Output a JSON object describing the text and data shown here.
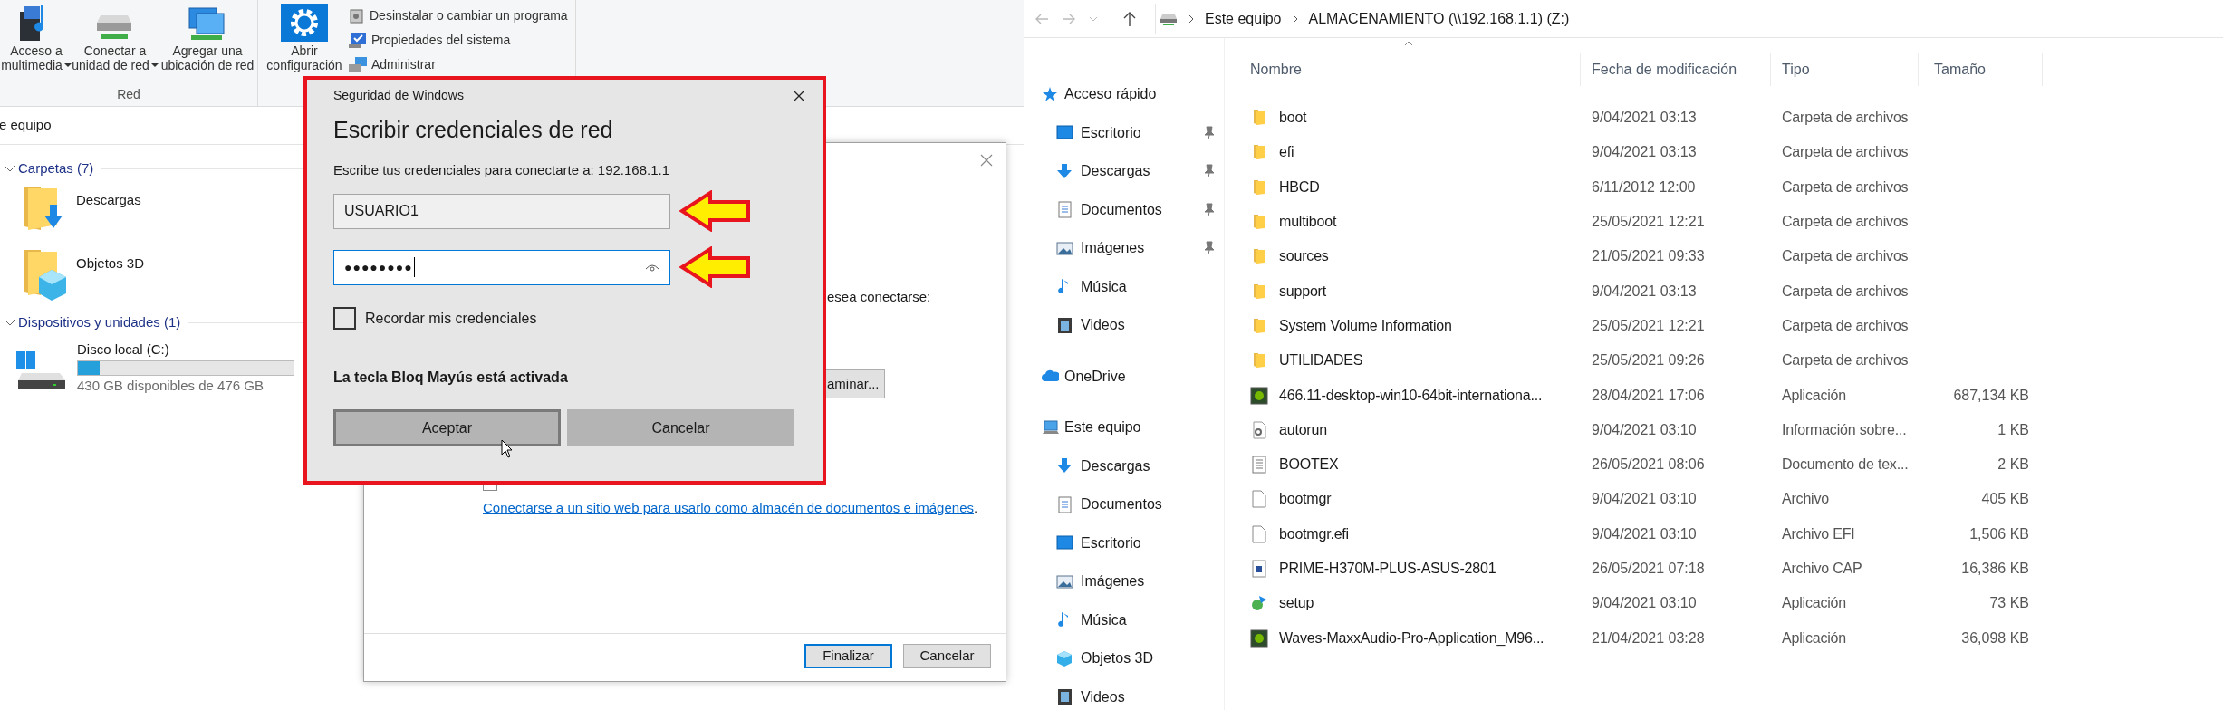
{
  "left_explorer": {
    "ribbon": {
      "groups": [
        {
          "label": "Red",
          "buttons": [
            {
              "kind": "media",
              "lines": [
                "Acceso a",
                "multimedia"
              ],
              "dropdown": true
            },
            {
              "kind": "netdrive",
              "lines": [
                "Conectar a",
                "unidad de red"
              ],
              "dropdown": true
            },
            {
              "kind": "netplace",
              "lines": [
                "Agregar una",
                "ubicación de red"
              ],
              "dropdown": false
            }
          ]
        },
        {
          "buttons": [
            {
              "kind": "settings",
              "lines": [
                "Abrir",
                "configuración"
              ],
              "dropdown": false
            }
          ],
          "small_items": [
            {
              "kind": "uninstall",
              "label": "Desinstalar o cambiar un programa"
            },
            {
              "kind": "sysprops",
              "label": "Propiedades del sistema"
            },
            {
              "kind": "manage",
              "label": "Administrar"
            }
          ]
        }
      ]
    },
    "address": "e equipo",
    "sections": [
      {
        "title": "Carpetas (7)",
        "expanded": true,
        "items": [
          {
            "kind": "downloads",
            "name": "Descargas"
          },
          {
            "kind": "objects3d",
            "name": "Objetos 3D"
          }
        ]
      },
      {
        "title": "Dispositivos y unidades (1)",
        "expanded": true,
        "items": [
          {
            "kind": "drive",
            "name": "Disco local (C:)",
            "level": 0.1,
            "detail": "430 GB disponibles de 476 GB"
          }
        ]
      }
    ]
  },
  "background_wizard": {
    "text_fragment": "esea conectarse:",
    "button_fragment": "aminar...",
    "checkbox": {
      "checked": false
    },
    "link": "Conectarse a un sitio web para usarlo como almacén de documentos e imágenes",
    "link_tail": ".",
    "buttons": [
      {
        "label": "Finalizar",
        "default": true
      },
      {
        "label": "Cancelar",
        "default": false
      }
    ]
  },
  "credential_dialog": {
    "window_title": "Seguridad de Windows",
    "heading": "Escribir credenciales de red",
    "prompt": "Escribe tus credenciales para conectarte a: 192.168.1.1",
    "username": {
      "value": "USUARIO1",
      "focused": false
    },
    "password": {
      "value": "●●●●●●●●",
      "focused": true
    },
    "remember": {
      "label": "Recordar mis credenciales",
      "checked": false
    },
    "caps_warning": "La tecla Bloq Mayús está activada",
    "buttons": [
      {
        "label": "Aceptar",
        "default": true
      },
      {
        "label": "Cancelar",
        "default": false
      }
    ]
  },
  "right_explorer": {
    "breadcrumb": [
      "Este equipo",
      "ALMACENAMIENTO (\\\\192.168.1.1) (Z:)"
    ],
    "nav": [
      {
        "kind": "star",
        "label": "Acceso rápido",
        "children": [
          {
            "kind": "desktop",
            "label": "Escritorio",
            "pinned": true
          },
          {
            "kind": "download",
            "label": "Descargas",
            "pinned": true
          },
          {
            "kind": "document",
            "label": "Documentos",
            "pinned": true
          },
          {
            "kind": "image",
            "label": "Imágenes",
            "pinned": true
          },
          {
            "kind": "music",
            "label": "Música",
            "pinned": false
          },
          {
            "kind": "video",
            "label": "Videos",
            "pinned": false
          }
        ]
      },
      {
        "kind": "cloud",
        "label": "OneDrive"
      },
      {
        "kind": "pc",
        "label": "Este equipo",
        "children": [
          {
            "kind": "download",
            "label": "Descargas",
            "pinned": false
          },
          {
            "kind": "document",
            "label": "Documentos",
            "pinned": false
          },
          {
            "kind": "desktop",
            "label": "Escritorio",
            "pinned": false
          },
          {
            "kind": "image",
            "label": "Imágenes",
            "pinned": false
          },
          {
            "kind": "music",
            "label": "Música",
            "pinned": false
          },
          {
            "kind": "cube",
            "label": "Objetos 3D",
            "pinned": false
          },
          {
            "kind": "video",
            "label": "Videos",
            "pinned": false
          }
        ]
      }
    ],
    "columns": [
      {
        "label": "Nombre",
        "sorted": true
      },
      {
        "label": "Fecha de modificación",
        "sorted": false
      },
      {
        "label": "Tipo",
        "sorted": false
      },
      {
        "label": "Tamaño",
        "sorted": false
      }
    ],
    "rows": [
      {
        "kind": "folder",
        "name": "boot",
        "date": "9/04/2021 03:13",
        "type": "Carpeta de archivos"
      },
      {
        "kind": "folder",
        "name": "efi",
        "date": "9/04/2021 03:13",
        "type": "Carpeta de archivos"
      },
      {
        "kind": "folder",
        "name": "HBCD",
        "date": "6/11/2012 12:00",
        "type": "Carpeta de archivos"
      },
      {
        "kind": "folder",
        "name": "multiboot",
        "date": "25/05/2021 12:21",
        "type": "Carpeta de archivos"
      },
      {
        "kind": "folder",
        "name": "sources",
        "date": "21/05/2021 09:33",
        "type": "Carpeta de archivos"
      },
      {
        "kind": "folder",
        "name": "support",
        "date": "9/04/2021 03:13",
        "type": "Carpeta de archivos"
      },
      {
        "kind": "folder",
        "name": "System Volume Information",
        "date": "25/05/2021 12:21",
        "type": "Carpeta de archivos"
      },
      {
        "kind": "folder",
        "name": "UTILIDADES",
        "date": "25/05/2021 09:26",
        "type": "Carpeta de archivos"
      },
      {
        "kind": "app",
        "name": "466.11-desktop-win10-64bit-internationa...",
        "date": "28/04/2021 17:06",
        "type": "Aplicación",
        "size": "687,134 KB"
      },
      {
        "kind": "setupinfo",
        "name": "autorun",
        "date": "9/04/2021 03:10",
        "type": "Información sobre...",
        "size": "1 KB"
      },
      {
        "kind": "text",
        "name": "BOOTEX",
        "date": "26/05/2021 08:06",
        "type": "Documento de tex...",
        "size": "2 KB"
      },
      {
        "kind": "file",
        "name": "bootmgr",
        "date": "9/04/2021 03:10",
        "type": "Archivo",
        "size": "405 KB"
      },
      {
        "kind": "file",
        "name": "bootmgr.efi",
        "date": "9/04/2021 03:10",
        "type": "Archivo EFI",
        "size": "1,506 KB"
      },
      {
        "kind": "cap",
        "name": "PRIME-H370M-PLUS-ASUS-2801",
        "date": "26/05/2021 07:18",
        "type": "Archivo CAP",
        "size": "16,386 KB"
      },
      {
        "kind": "installer",
        "name": "setup",
        "date": "9/04/2021 03:10",
        "type": "Aplicación",
        "size": "73 KB"
      },
      {
        "kind": "app",
        "name": "Waves-MaxxAudio-Pro-Application_M96...",
        "date": "21/04/2021 03:28",
        "type": "Aplicación",
        "size": "36,098 KB"
      }
    ]
  }
}
